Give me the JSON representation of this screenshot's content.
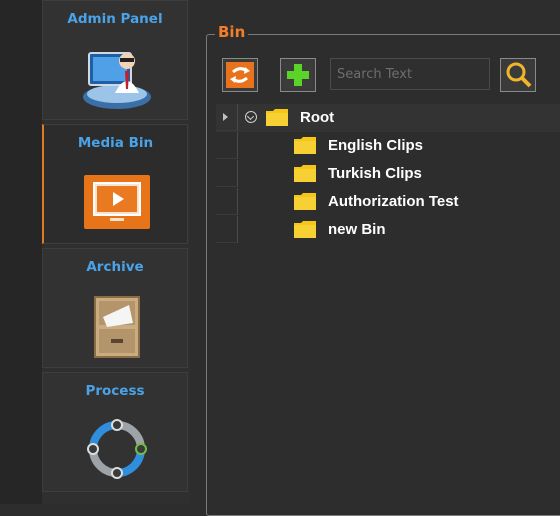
{
  "sidebar": {
    "items": [
      {
        "label": "Admin Panel",
        "icon": "admin-panel-icon",
        "active": false
      },
      {
        "label": "Media Bin",
        "icon": "media-bin-icon",
        "active": true
      },
      {
        "label": "Archive",
        "icon": "archive-cabinet-icon",
        "active": false
      },
      {
        "label": "Process",
        "icon": "process-cycle-icon",
        "active": false
      }
    ]
  },
  "bin": {
    "title": "Bin",
    "toolbar": {
      "refresh_icon": "refresh-arrows-icon",
      "add_icon": "add-plus-icon",
      "search_placeholder": "Search Text",
      "search_value": "",
      "search_icon": "magnifier-icon"
    },
    "tree": {
      "root": {
        "label": "Root",
        "icon": "folder-icon"
      },
      "children": [
        {
          "label": "English Clips"
        },
        {
          "label": "Turkish Clips"
        },
        {
          "label": "Authorization Test"
        },
        {
          "label": "new Bin"
        }
      ]
    }
  },
  "colors": {
    "accent_orange": "#f07e2b",
    "link_blue": "#4aa3e8",
    "background": "#2d2d2d",
    "folder_yellow": "#f5c518"
  }
}
